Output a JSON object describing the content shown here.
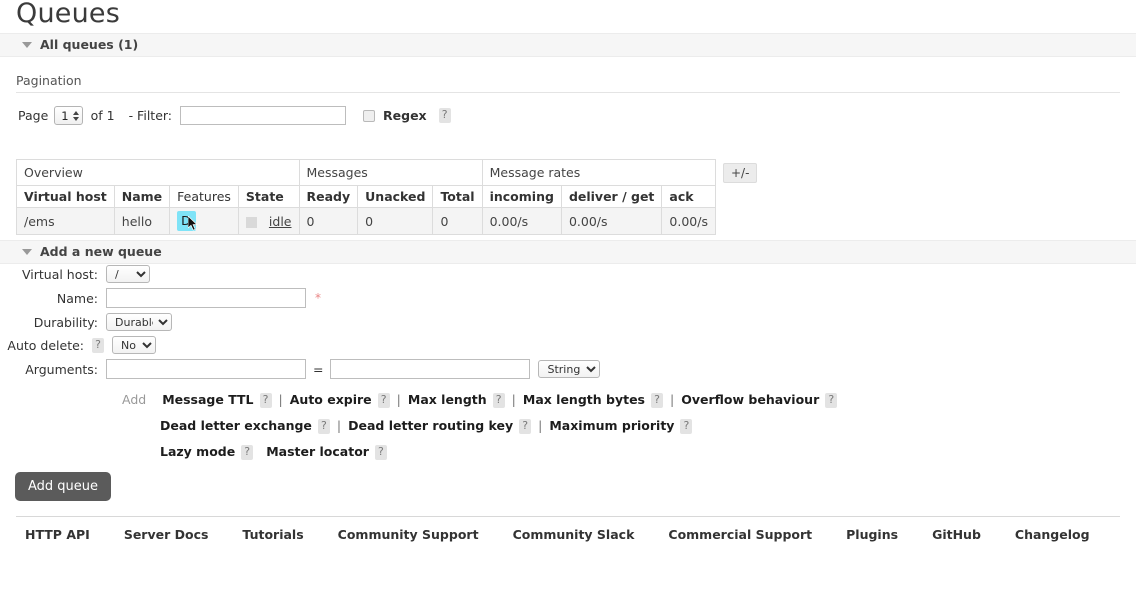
{
  "page": {
    "title": "Queues"
  },
  "all_queues_section": {
    "label": "All queues (1)"
  },
  "pagination": {
    "title": "Pagination",
    "page_label": "Page",
    "page_value": "1",
    "of_label": "of 1",
    "filter_label": "- Filter:",
    "filter_value": "",
    "regex_label": "Regex",
    "help": "?"
  },
  "table": {
    "group_headers": [
      {
        "label": "Overview",
        "span": 4
      },
      {
        "label": "Messages",
        "span": 3
      },
      {
        "label": "Message rates",
        "span": 3
      }
    ],
    "toggle_label": "+/-",
    "columns": [
      {
        "label": "Virtual host",
        "sortable": true
      },
      {
        "label": "Name",
        "sortable": true
      },
      {
        "label": "Features",
        "sortable": false
      },
      {
        "label": "State",
        "sortable": true
      },
      {
        "label": "Ready",
        "sortable": true
      },
      {
        "label": "Unacked",
        "sortable": true
      },
      {
        "label": "Total",
        "sortable": true
      },
      {
        "label": "incoming",
        "sortable": true
      },
      {
        "label": "deliver / get",
        "sortable": true
      },
      {
        "label": "ack",
        "sortable": true
      }
    ],
    "rows": [
      {
        "vhost": "/ems",
        "name": "hello",
        "features": "D",
        "state": "idle",
        "ready": "0",
        "unacked": "0",
        "total": "0",
        "incoming": "0.00/s",
        "deliver_get": "0.00/s",
        "ack": "0.00/s"
      }
    ]
  },
  "add_queue_section": {
    "label": "Add a new queue",
    "fields": {
      "virtual_host_label": "Virtual host:",
      "virtual_host_value": "/",
      "name_label": "Name:",
      "name_value": "",
      "name_required": "*",
      "durability_label": "Durability:",
      "durability_value": "Durable",
      "auto_delete_label": "Auto delete:",
      "auto_delete_help": "?",
      "auto_delete_value": "No",
      "arguments_label": "Arguments:",
      "arg_key_value": "",
      "arg_equals": "=",
      "arg_val_value": "",
      "arg_type_value": "String"
    },
    "presets": {
      "add_label": "Add",
      "line1": [
        {
          "label": "Message TTL",
          "help": "?"
        },
        {
          "label": "Auto expire",
          "help": "?"
        },
        {
          "label": "Max length",
          "help": "?"
        },
        {
          "label": "Max length bytes",
          "help": "?"
        },
        {
          "label": "Overflow behaviour",
          "help": "?"
        }
      ],
      "line2": [
        {
          "label": "Dead letter exchange",
          "help": "?"
        },
        {
          "label": "Dead letter routing key",
          "help": "?"
        },
        {
          "label": "Maximum priority",
          "help": "?"
        }
      ],
      "line3": [
        {
          "label": "Lazy mode",
          "help": "?"
        },
        {
          "label": "Master locator",
          "help": "?"
        }
      ]
    },
    "submit_label": "Add queue"
  },
  "footer": {
    "links": [
      "HTTP API",
      "Server Docs",
      "Tutorials",
      "Community Support",
      "Community Slack",
      "Commercial Support",
      "Plugins",
      "GitHub",
      "Changelog"
    ]
  },
  "colors": {
    "selection_highlight": "#7fe3f7",
    "button_bg": "#5b5b5b",
    "section_bar_bg": "#f6f6f6",
    "row_bg": "#f4f4f4",
    "required_star": "#e98585"
  }
}
